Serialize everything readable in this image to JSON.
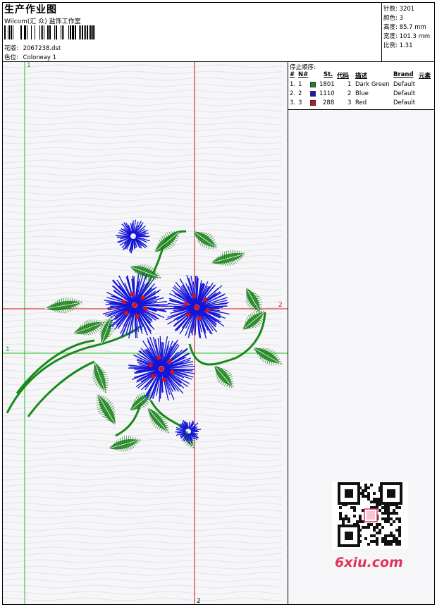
{
  "header": {
    "title": "生产作业图",
    "company": "Wilcom(汇 众) 盐饰工作室",
    "design_label": "花版:",
    "design_value": "2067238.dst",
    "colorway_label": "色位:",
    "colorway_value": "Colorway 1"
  },
  "stats": {
    "stitches": "针数: 3201",
    "colors": "颜色: 3",
    "height": "高度: 85.7 mm",
    "width": "宽度: 101.3 mm",
    "scale": "比例: 1.31"
  },
  "stop_table": {
    "title": "停止顺序:",
    "headers": [
      "#",
      "N#",
      "St.",
      "代码",
      "描述",
      "Brand",
      "元素"
    ],
    "rows": [
      {
        "num": "1.",
        "n": "1",
        "color": "#1a8a1a",
        "st": "1801",
        "code": "1",
        "desc": "Dark Green",
        "brand": "Default"
      },
      {
        "num": "2.",
        "n": "2",
        "color": "#1515d8",
        "st": "1110",
        "code": "2",
        "desc": "Blue",
        "brand": "Default"
      },
      {
        "num": "3.",
        "n": "3",
        "color": "#e01010",
        "st": "288",
        "code": "3",
        "desc": "Red",
        "brand": "Default"
      }
    ]
  },
  "guides": {
    "v1_label": "1",
    "v2_label": "2",
    "h1_label": "1",
    "h2_label": "2"
  },
  "watermark": {
    "text": "6xiu.com",
    "qr_stamp": "汉绣图库"
  },
  "colors": {
    "green_thread": "#1a8a1a",
    "blue_thread": "#1515d8",
    "red_thread": "#e01010",
    "guide_red": "#d01010",
    "guide_green": "#20c020"
  }
}
